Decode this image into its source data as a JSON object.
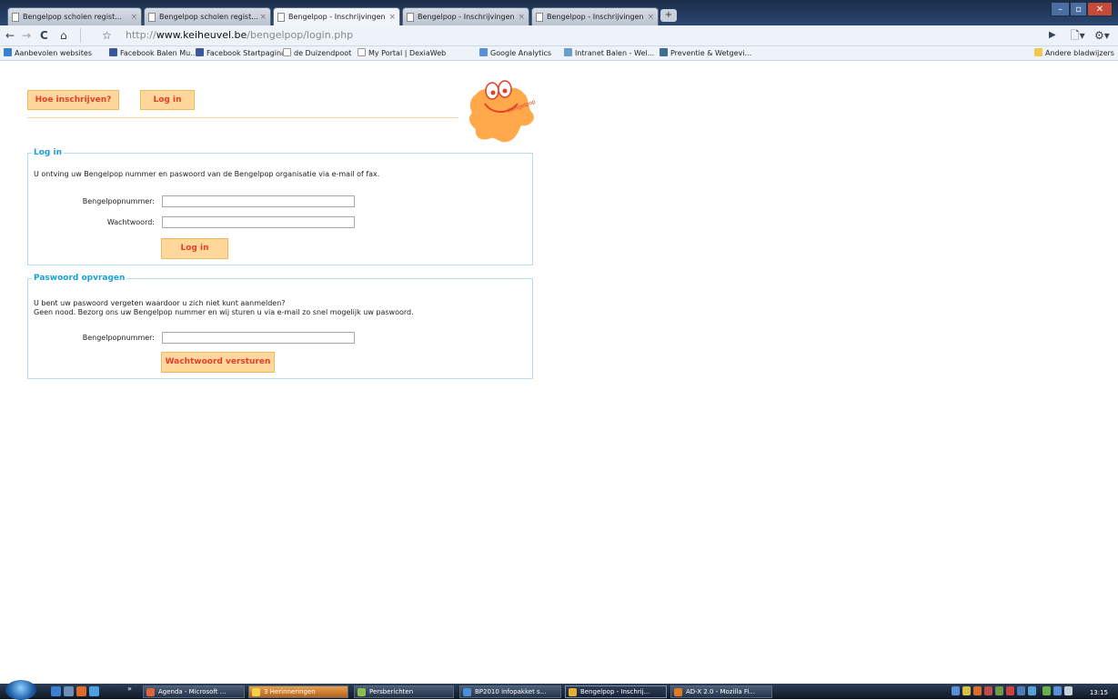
{
  "tabs": [
    {
      "label": "Bengelpop scholen regist...",
      "active": false
    },
    {
      "label": "Bengelpop scholen regist...",
      "active": false
    },
    {
      "label": "Bengelpop - Inschrijvingen",
      "active": true
    },
    {
      "label": "Bengelpop - Inschrijvingen",
      "active": false
    },
    {
      "label": "Bengelpop - Inschrijvingen",
      "active": false
    }
  ],
  "tab_close": "×",
  "new_tab": "+",
  "url": {
    "prefix": "http://",
    "domain": "www.keiheuvel.be",
    "path": "/bengelpop/login.php"
  },
  "bookmarks": [
    "Aanbevolen websites",
    "Facebook Balen Mu...",
    "Facebook Startpagina",
    "de Duizendpoot",
    "My Portal | DexiaWeb",
    "Google Analytics",
    "Intranet Balen - Wel...",
    "Preventie & Wetgevi...",
    "Andere bladwijzers"
  ],
  "nav": {
    "how": "Hoe inschrijven?",
    "login": "Log in"
  },
  "logo_text": "Bengelpop",
  "login_section": {
    "legend": "Log in",
    "intro": "U ontving uw Bengelpop nummer en paswoord van de Bengelpop organisatie via e-mail of fax.",
    "number_label": "Bengelpopnummer:",
    "password_label": "Wachtwoord:",
    "submit": "Log in"
  },
  "password_section": {
    "legend": "Paswoord opvragen",
    "line1": "U bent uw paswoord vergeten waardoor u zich niet kunt aanmelden?",
    "line2": "Geen nood. Bezorg ons uw Bengelpop nummer en wij sturen u via e-mail zo snel mogelijk uw paswoord.",
    "number_label": "Bengelpopnummer:",
    "submit": "Wachtwoord versturen"
  },
  "taskbar": {
    "overflow": "»",
    "items": [
      {
        "label": "Agenda - Microsoft ...",
        "state": "normal",
        "color": "#e0643a"
      },
      {
        "label": "3 Herinneringen",
        "state": "highlight",
        "color": "#f5d24a"
      },
      {
        "label": "Persberichten",
        "state": "normal",
        "color": "#8cbf4a"
      },
      {
        "label": "BP2010 infopakket s...",
        "state": "normal",
        "color": "#4a8fd8"
      },
      {
        "label": "Bengelpop - Inschrij...",
        "state": "active",
        "color": "#e8b030"
      },
      {
        "label": "AD-X 2.0 - Mozilla Fi...",
        "state": "normal",
        "color": "#e07a22"
      }
    ],
    "clock": "13:15"
  }
}
